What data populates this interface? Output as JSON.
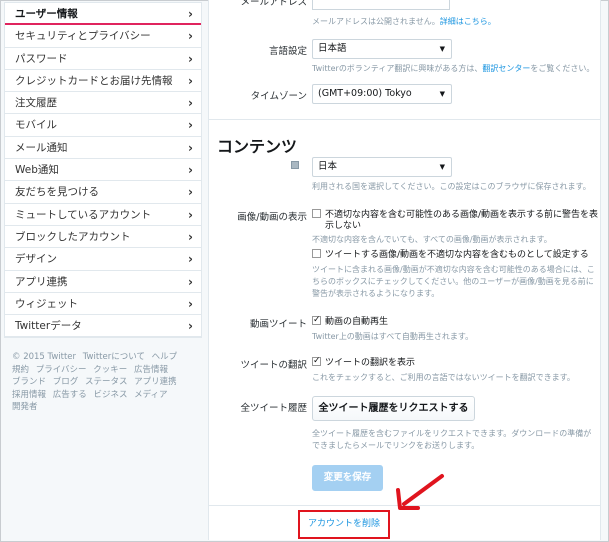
{
  "sidebar": {
    "items": [
      {
        "label": "ユーザー情報"
      },
      {
        "label": "セキュリティとプライバシー"
      },
      {
        "label": "パスワード"
      },
      {
        "label": "クレジットカードとお届け先情報"
      },
      {
        "label": "注文履歴"
      },
      {
        "label": "モバイル"
      },
      {
        "label": "メール通知"
      },
      {
        "label": "Web通知"
      },
      {
        "label": "友だちを見つける"
      },
      {
        "label": "ミュートしているアカウント"
      },
      {
        "label": "ブロックしたアカウント"
      },
      {
        "label": "デザイン"
      },
      {
        "label": "アプリ連携"
      },
      {
        "label": "ウィジェット"
      },
      {
        "label": "Twitterデータ"
      }
    ],
    "chevron": "›",
    "footer_links": [
      "© 2015 Twitter",
      "Twitterについて",
      "ヘルプ",
      "規約",
      "プライバシー",
      "クッキー",
      "広告情報",
      "ブランド",
      "ブログ",
      "ステータス",
      "アプリ連携",
      "採用情報",
      "広告する",
      "ビジネス",
      "メディア",
      "開発者"
    ]
  },
  "account": {
    "email_label": "メールアドレス",
    "email_help": "メールアドレスは公開されません。",
    "email_help_link": "詳細はこちら。",
    "language_label": "言語設定",
    "language_value": "日本語",
    "language_help": "Twitterのボランティア翻訳に興味がある方は、",
    "language_help_link": "翻訳センター",
    "language_help_tail": "をご覧ください。",
    "timezone_label": "タイムゾーン",
    "timezone_value": "(GMT+09:00) Tokyo"
  },
  "content": {
    "title": "コンテンツ",
    "country_value": "日本",
    "country_help": "利用される国を選択してください。この設定はこのブラウザに保存されます。",
    "media_label": "画像/動画の表示",
    "media_opt1": "不適切な内容を含む可能性のある画像/動画を表示する前に警告を表",
    "media_opt1_b": "示しない",
    "media_opt1_help": "不適切な内容を含んでいても、すべての画像/動画が表示されます。",
    "media_opt2": "ツイートする画像/動画を不適切な内容を含むものとして設定する",
    "media_opt2_help1": "ツイートに含まれる画像/動画が不適切な内容を含む可能性のある場合には、こ",
    "media_opt2_help2": "ちらのボックスにチェックしてください。他のユーザーが画像/動画を見る前に",
    "media_opt2_help3": "警告が表示されるようになります。",
    "video_label": "動画ツイート",
    "video_opt": "動画の自動再生",
    "video_help": "Twitter上の動画はすべて自動再生されます。",
    "translate_label": "ツイートの翻訳",
    "translate_opt": "ツイートの翻訳を表示",
    "translate_help": "これをチェックすると、ご利用の言語ではないツイートを翻訳できます。",
    "archive_label": "全ツイート履歴",
    "archive_button": "全ツイート履歴をリクエストする",
    "archive_help1": "全ツイート履歴を含むファイルをリクエストできます。ダウンロードの準備が",
    "archive_help2": "できましたらメールでリンクをお送りします。",
    "save_button": "変更を保存",
    "delete_link": "アカウントを削除"
  },
  "colors": {
    "accent": "#1b95e0",
    "highlight": "#e0141e",
    "active_underline": "#e0245e"
  }
}
